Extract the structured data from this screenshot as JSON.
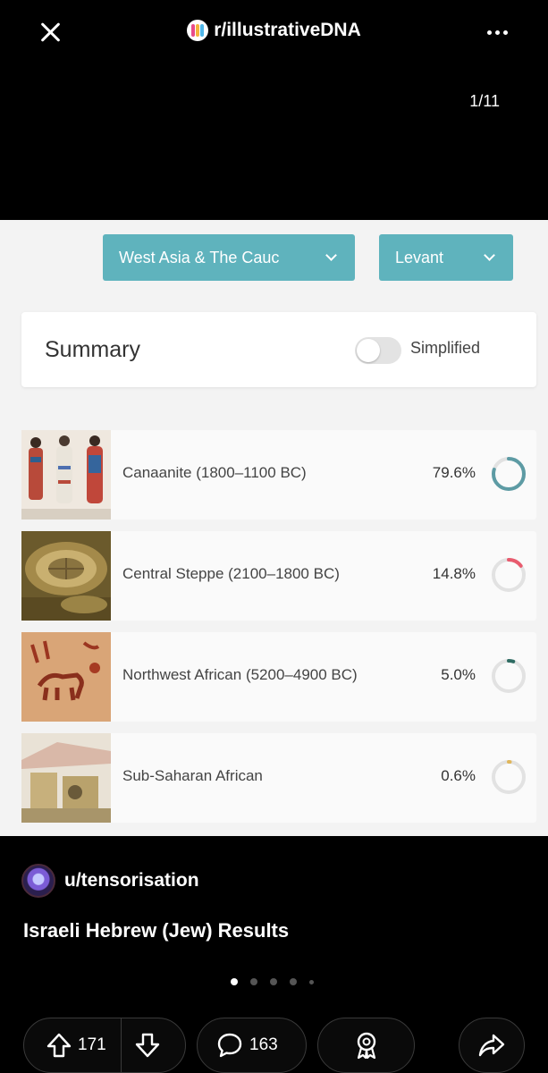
{
  "header": {
    "subreddit": "r/illustrativeDNA",
    "pager": "1/11",
    "icons": {
      "close": "close-icon",
      "more": "more-horizontal-icon",
      "subreddit": "subreddit-logo-icon"
    }
  },
  "image": {
    "dropdowns": [
      {
        "label": "West Asia & The Cauc"
      },
      {
        "label": "Levant"
      }
    ],
    "summary": {
      "title": "Summary",
      "toggle_label": "Simplified",
      "toggle_on": false
    },
    "results": [
      {
        "name": "Canaanite (1800–1100 BC)",
        "percent": "79.6%",
        "value": 79.6,
        "color": "#5d9ba4"
      },
      {
        "name": "Central Steppe (2100–1800 BC)",
        "percent": "14.8%",
        "value": 14.8,
        "color": "#e85b6e"
      },
      {
        "name": "Northwest African (5200–4900 BC)",
        "percent": "5.0%",
        "value": 5.0,
        "color": "#2e6b62"
      },
      {
        "name": "Sub-Saharan African",
        "percent": "0.6%",
        "value": 0.6,
        "color": "#e0b65a"
      }
    ],
    "accent": "#5fb3bd"
  },
  "post": {
    "author": "u/tensorisation",
    "title": "Israeli Hebrew (Jew) Results"
  },
  "actions": {
    "upvotes": "171",
    "comments": "163",
    "icons": {
      "upvote": "upvote-arrow-icon",
      "downvote": "downvote-arrow-icon",
      "comment": "comment-bubble-icon",
      "award": "award-icon",
      "share": "share-arrow-icon"
    }
  }
}
